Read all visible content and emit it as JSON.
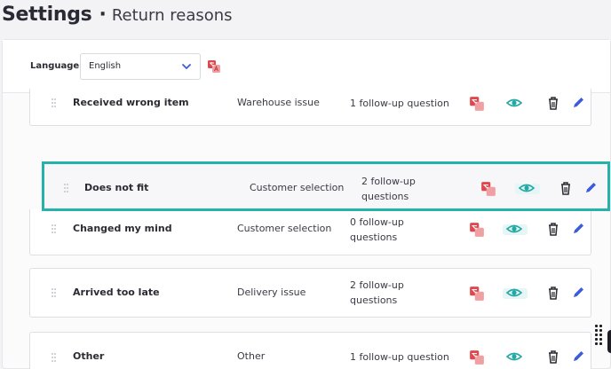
{
  "header": {
    "title": "Settings",
    "separator": "·",
    "subtitle": "Return reasons"
  },
  "language": {
    "label": "Language",
    "selected": "English"
  },
  "reasons": [
    {
      "name": "Received wrong item",
      "category": "Warehouse issue",
      "followups_line1": "1 follow-up question",
      "followups_line2": ""
    },
    {
      "name": "Does not fit",
      "category": "Customer selection",
      "followups_line1": "2 follow-up",
      "followups_line2": "questions",
      "dragging": true
    },
    {
      "name": "Changed my mind",
      "category": "Customer selection",
      "followups_line1": "0 follow-up",
      "followups_line2": "questions"
    },
    {
      "name": "Arrived too late",
      "category": "Delivery issue",
      "followups_line1": "2 follow-up",
      "followups_line2": "questions"
    },
    {
      "name": "Other",
      "category": "Other",
      "followups_line1": "1 follow-up question",
      "followups_line2": ""
    }
  ],
  "icons": {
    "translate": "translate-icon",
    "view": "eye-icon",
    "delete": "trash-icon",
    "edit": "pencil-icon",
    "drag": "drag-handle-icon",
    "dropdown": "chevron-down-icon"
  },
  "colors": {
    "accent": "#25b2aa",
    "translate_red": "#e0474c",
    "edit_blue": "#3b5bdb",
    "eye_teal": "#24a8a3"
  }
}
